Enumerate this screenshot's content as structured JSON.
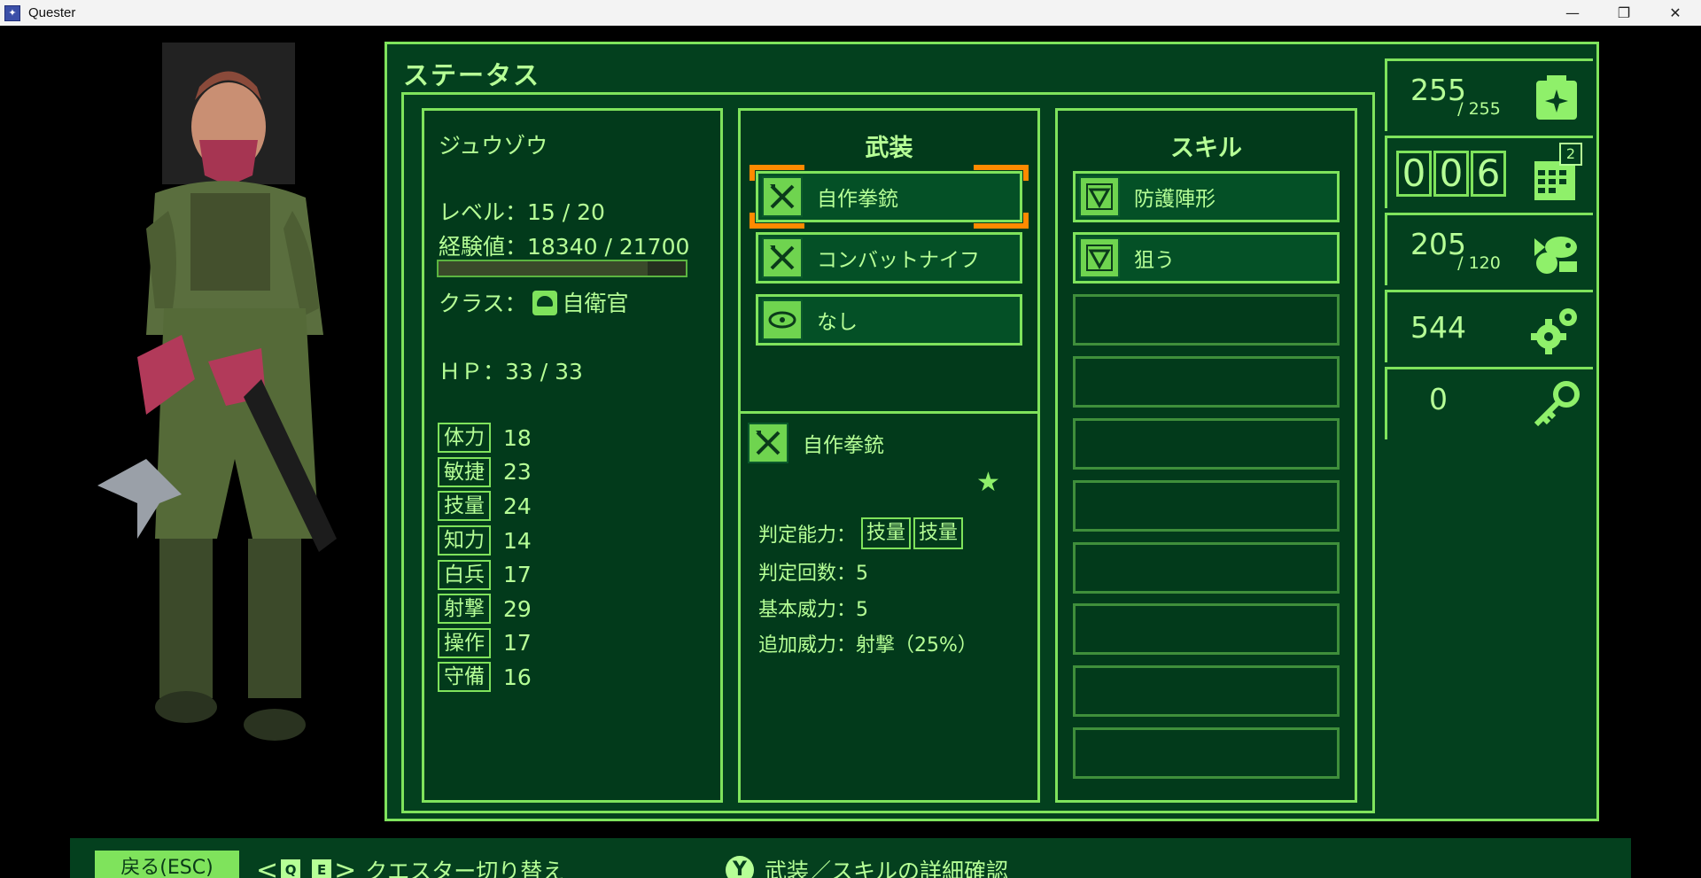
{
  "window": {
    "title": "Quester"
  },
  "panel": {
    "title": "ステータス"
  },
  "character": {
    "name": "ジュウゾウ",
    "level_line": "レベル：15 / 20",
    "exp_line": "経験値：18340 / 21700",
    "exp_progress": 0.845,
    "class_label": "クラス：",
    "class_name": "自衛官",
    "hp_line": "ＨＰ：33 / 33",
    "stats": [
      {
        "label": "体力",
        "value": "18"
      },
      {
        "label": "敏捷",
        "value": "23"
      },
      {
        "label": "技量",
        "value": "24"
      },
      {
        "label": "知力",
        "value": "14"
      },
      {
        "label": "白兵",
        "value": "17"
      },
      {
        "label": "射撃",
        "value": "29"
      },
      {
        "label": "操作",
        "value": "17"
      },
      {
        "label": "守備",
        "value": "16"
      }
    ]
  },
  "arms": {
    "heading": "武装",
    "slots": [
      {
        "label": "自作拳銃",
        "icon": "crossed-weapons-icon"
      },
      {
        "label": "コンバットナイフ",
        "icon": "crossed-weapons-icon"
      },
      {
        "label": "なし",
        "icon": "accessory-icon"
      }
    ],
    "detail": {
      "name": "自作拳銃",
      "star": "★",
      "check_label": "判定能力：",
      "check_tags": [
        "技量",
        "技量"
      ],
      "count_line": "判定回数：5",
      "power_line": "基本威力：5",
      "bonus_line": "追加威力：射撃（25%）"
    }
  },
  "skills": {
    "heading": "スキル",
    "slots": [
      "防護陣形",
      "狙う",
      "",
      "",
      "",
      "",
      "",
      "",
      "",
      ""
    ]
  },
  "side": {
    "food_value": "255",
    "food_max": "/ 255",
    "day_digits": [
      "0",
      "0",
      "6"
    ],
    "calendar_badge": "2",
    "fish_value": "205",
    "fish_max": "/ 120",
    "parts_value": "544",
    "keys_value": "0"
  },
  "hints": {
    "back_label": "戻る(ESC)",
    "key_q": "Q",
    "key_e": "E",
    "switch_label": "クエスター切り替え",
    "y_button": "Y",
    "detail_label": "武装／スキルの詳細確認"
  },
  "colors": {
    "panel_bg": "#03401e",
    "border": "#7fe35c",
    "text": "#b6ff96",
    "selection": "#ff8a00"
  }
}
